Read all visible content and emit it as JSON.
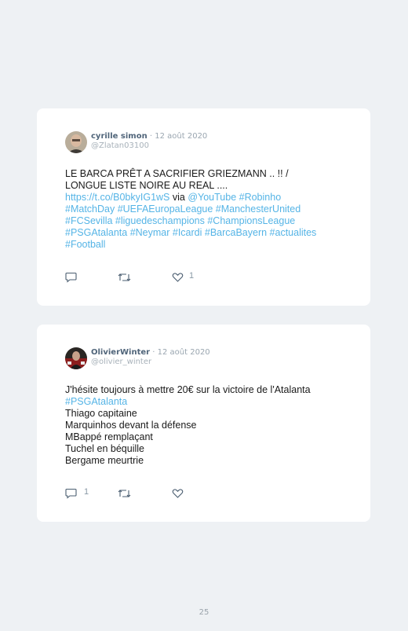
{
  "tweets": [
    {
      "author_name": "cyrille simon",
      "date": " · 12 août 2020",
      "handle": "@Zlatan03100",
      "line1": "LE BARCA PRÊT A SACRIFIER GRIEZMANN .. !! /",
      "line2": "LONGUE LISTE NOIRE AU REAL ....",
      "line3_link1": "https://t.co/B0bkyIG1wS",
      "line3_via": " via ",
      "line3_link2": "@YouTube #Robinho",
      "line4": "#MatchDay #UEFAEuropaLeague #ManchesterUnited",
      "line5": "#FCSevilla #liguedeschampions #ChampionsLeague",
      "line6": "#PSGAtalanta #Neymar #Icardi #BarcaBayern #actualites",
      "line7": "#Football",
      "reply_count": "",
      "retweet_count": "",
      "like_count": "1"
    },
    {
      "author_name": "OlivierWinter",
      "date": " · 12 août 2020",
      "handle": "@olivier_winter",
      "line1": "J'hésite toujours à mettre 20€ sur la victoire de l'Atalanta",
      "line2": "#PSGAtalanta",
      "line3": "Thiago capitaine",
      "line4": "Marquinhos devant la défense",
      "line5": "MBappé remplaçant",
      "line6": "Tuchel en béquille",
      "line7": "Bergame meurtrie",
      "reply_count": "1",
      "retweet_count": "",
      "like_count": ""
    }
  ],
  "page_number": "25",
  "colors": {
    "link": "#55b4e6",
    "background": "#eef1f4",
    "card": "#ffffff"
  },
  "icons": [
    "reply-icon",
    "retweet-icon",
    "like-icon"
  ]
}
